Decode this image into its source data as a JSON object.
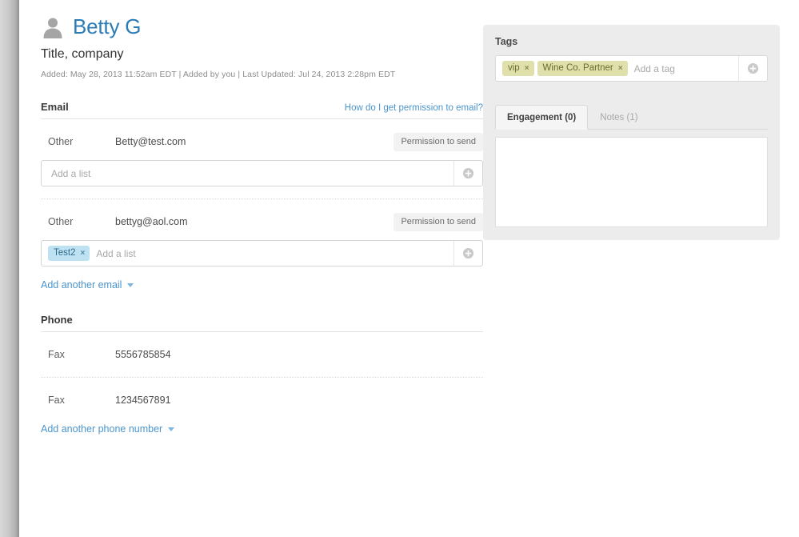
{
  "contact": {
    "name": "Betty G",
    "title": "Title, company",
    "meta": "Added: May 28, 2013 11:52am EDT | Added by you | Last Updated: Jul 24, 2013 2:28pm EDT",
    "avatar_icon": "person-icon"
  },
  "email_section": {
    "title": "Email",
    "help_link": "How do I get permission to email?",
    "add_link": "Add another email",
    "entries": [
      {
        "type": "Other",
        "address": "Betty@test.com",
        "permission_button": "Permission to send",
        "list_placeholder": "Add a list",
        "lists": []
      },
      {
        "type": "Other",
        "address": "bettyg@aol.com",
        "permission_button": "Permission to send",
        "list_placeholder": "Add a list",
        "lists": [
          {
            "label": "Test2",
            "remove": "×"
          }
        ]
      }
    ]
  },
  "phone_section": {
    "title": "Phone",
    "add_link": "Add another phone number",
    "entries": [
      {
        "type": "Fax",
        "number": "5556785854"
      },
      {
        "type": "Fax",
        "number": "1234567891"
      }
    ]
  },
  "side_panel": {
    "tags": {
      "label": "Tags",
      "placeholder": "Add a tag",
      "items": [
        {
          "label": "vip",
          "remove": "×"
        },
        {
          "label": "Wine Co. Partner",
          "remove": "×"
        }
      ]
    },
    "tabs": [
      {
        "label": "Engagement (0)",
        "active": true
      },
      {
        "label": "Notes (1)",
        "active": false
      }
    ]
  },
  "icons": {
    "plus": "plus-circle-icon",
    "caret": "chevron-down-icon"
  },
  "colors": {
    "link": "#4a95cf",
    "name": "#2b7cb5",
    "chip_blue_bg": "#bfe2f3",
    "chip_olive_bg": "#dfe0ab",
    "panel_bg": "#ececec"
  }
}
